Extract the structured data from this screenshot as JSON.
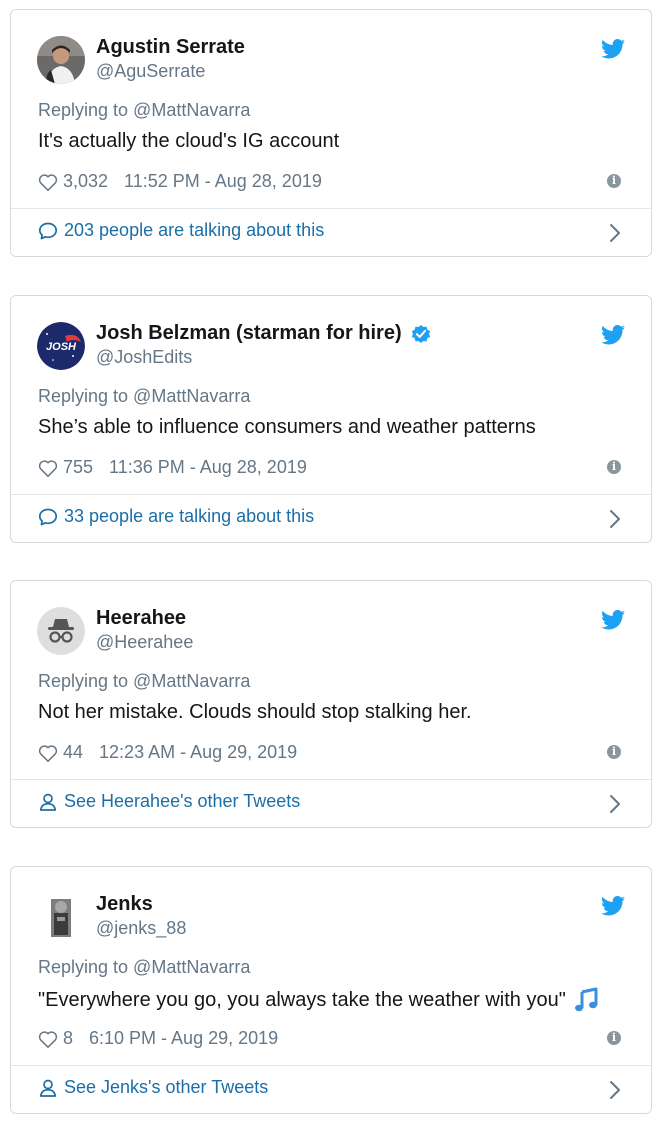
{
  "tweets": [
    {
      "name": "Agustin Serrate",
      "handle": "@AguSerrate",
      "verified": false,
      "replying_to": "Replying to @MattNavarra",
      "text": "It's actually the cloud's IG account",
      "likes": "3,032",
      "timestamp": "11:52 PM - Aug 28, 2019",
      "footer": "203 people are talking about this",
      "footer_icon": "comment-icon"
    },
    {
      "name": "Josh Belzman (starman for hire)",
      "handle": "@JoshEdits",
      "verified": true,
      "avatar_text": "JOSH",
      "replying_to": "Replying to @MattNavarra",
      "text": "She’s able to influence consumers and weather patterns",
      "likes": "755",
      "timestamp": "11:36 PM - Aug 28, 2019",
      "footer": "33 people are talking about this",
      "footer_icon": "comment-icon"
    },
    {
      "name": "Heerahee",
      "handle": "@Heerahee",
      "verified": false,
      "replying_to": "Replying to @MattNavarra",
      "text": "Not her mistake. Clouds should stop stalking her.",
      "likes": "44",
      "timestamp": "12:23 AM - Aug 29, 2019",
      "footer": "See Heerahee's other Tweets",
      "footer_icon": "person-icon"
    },
    {
      "name": "Jenks",
      "handle": "@jenks_88",
      "verified": false,
      "replying_to": "Replying to @MattNavarra",
      "text": "\"Everywhere you go, you always take the weather with you\"",
      "text_emoji": "music-note-icon",
      "likes": "8",
      "timestamp": "6:10 PM - Aug 29, 2019",
      "footer": "See Jenks's other Tweets",
      "footer_icon": "person-icon"
    }
  ],
  "colors": {
    "twitter_blue": "#1da1f2",
    "link_blue": "#1b6ea8",
    "secondary_text": "#657786",
    "border": "#d4dbe0"
  }
}
